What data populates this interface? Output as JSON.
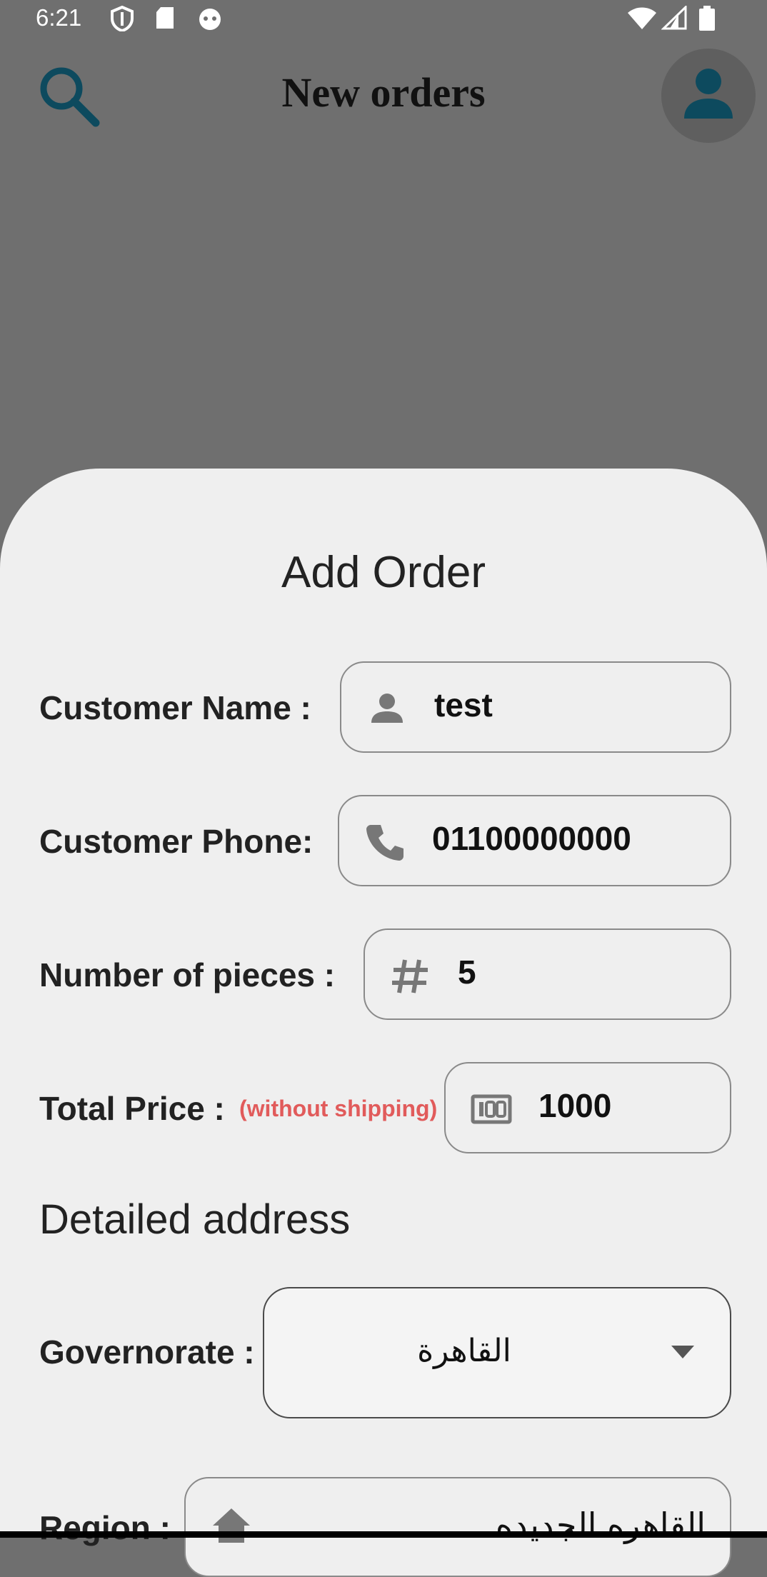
{
  "status_bar": {
    "time": "6:21",
    "icons": [
      "shield-icon",
      "sd-card-icon",
      "cat-icon",
      "wifi-icon",
      "signal-icon",
      "battery-icon"
    ]
  },
  "app_bar": {
    "title": "New orders",
    "left_icon": "search-icon",
    "right_icon": "account-icon",
    "accent_color": "#0d4a5e"
  },
  "sheet": {
    "title": "Add Order",
    "fields": [
      {
        "label": "Customer Name :",
        "icon": "person-icon",
        "value": "test"
      },
      {
        "label": "Customer Phone:",
        "icon": "phone-icon",
        "value": "01100000000"
      },
      {
        "label": "Number of pieces :",
        "icon": "hash-icon",
        "value": "5"
      },
      {
        "label": "Total Price :",
        "hint": "(without shipping)",
        "icon": "money-icon",
        "value": "1000"
      }
    ],
    "address_section": "Detailed address",
    "governorate": {
      "label": "Governorate :",
      "value": "القاهرة"
    },
    "region": {
      "label": "Region :",
      "icon": "home-icon",
      "value": "القاهره الجديده"
    },
    "hint_color": "#e15b5b"
  }
}
